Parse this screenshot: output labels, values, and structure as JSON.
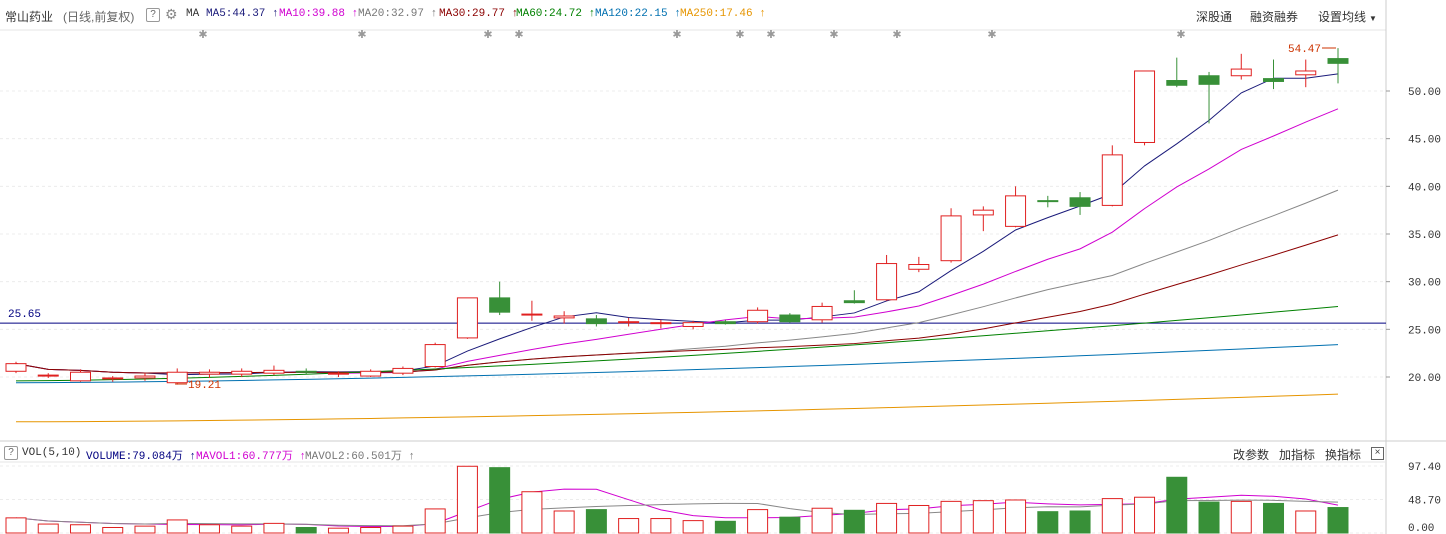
{
  "header": {
    "stock_name": "常山药业",
    "period_label": "(日线,前复权)",
    "ma_label": "MA",
    "ma_items": [
      {
        "label": "MA5:44.37",
        "color": "#1a1a7a"
      },
      {
        "label": "MA10:39.88",
        "color": "#d000d0"
      },
      {
        "label": "MA20:32.97",
        "color": "#777777"
      },
      {
        "label": "MA30:29.77",
        "color": "#8b0000"
      },
      {
        "label": "MA60:24.72",
        "color": "#008000"
      },
      {
        "label": "MA120:22.15",
        "color": "#0070b0"
      },
      {
        "label": "MA250:17.46",
        "color": "#e69500"
      }
    ],
    "buttons": {
      "shengutong": "深股通",
      "rongzi": "融资融券",
      "setma": "设置均线"
    }
  },
  "volume_header": {
    "vol_label": "VOL(5,10)",
    "items": [
      {
        "label": "VOLUME:79.084万",
        "color": "#000080"
      },
      {
        "label": "MAVOL1:60.777万",
        "color": "#d000d0"
      },
      {
        "label": "MAVOL2:60.501万",
        "color": "#777777"
      }
    ],
    "buttons": {
      "params": "改参数",
      "add": "加指标",
      "switch": "换指标"
    }
  },
  "colors": {
    "up": "#e02020",
    "down": "#389038",
    "ref_line": "#000080",
    "ma5": "#1a1a7a",
    "ma10": "#d000d0",
    "ma20": "#888888",
    "ma30": "#8b0000",
    "ma60": "#008000",
    "ma120": "#0070b0",
    "ma250": "#e69500",
    "mavol1": "#d000d0",
    "mavol2": "#888888"
  },
  "chart_data": {
    "type": "candlestick",
    "price_axis": {
      "ticks": [
        "50.00",
        "45.00",
        "40.00",
        "35.00",
        "30.00",
        "25.00",
        "20.00"
      ],
      "range": [
        15.0,
        55.0
      ]
    },
    "volume_axis": {
      "ticks": [
        "97.40",
        "48.70",
        "0.00"
      ],
      "range": [
        0,
        105
      ]
    },
    "reference_line": {
      "value": 25.65,
      "label": "25.65"
    },
    "annotations": {
      "max_label": "54.47",
      "min_label": "19.21"
    },
    "candles": [
      {
        "o": 20.6,
        "h": 21.6,
        "l": 20.4,
        "c": 21.4
      },
      {
        "o": 20.2,
        "h": 20.4,
        "l": 19.9,
        "c": 20.2
      },
      {
        "o": 19.6,
        "h": 20.8,
        "l": 19.5,
        "c": 20.5
      },
      {
        "o": 19.8,
        "h": 20.1,
        "l": 19.5,
        "c": 19.9
      },
      {
        "o": 19.9,
        "h": 20.4,
        "l": 19.6,
        "c": 20.1
      },
      {
        "o": 19.4,
        "h": 20.9,
        "l": 19.2,
        "c": 20.5
      },
      {
        "o": 20.3,
        "h": 20.8,
        "l": 19.9,
        "c": 20.5
      },
      {
        "o": 20.3,
        "h": 20.9,
        "l": 20.0,
        "c": 20.6
      },
      {
        "o": 20.4,
        "h": 21.2,
        "l": 20.2,
        "c": 20.7
      },
      {
        "o": 20.6,
        "h": 20.9,
        "l": 20.3,
        "c": 20.5
      },
      {
        "o": 20.3,
        "h": 20.6,
        "l": 20.0,
        "c": 20.4
      },
      {
        "o": 20.1,
        "h": 20.8,
        "l": 20.0,
        "c": 20.6
      },
      {
        "o": 20.4,
        "h": 21.1,
        "l": 20.2,
        "c": 20.9
      },
      {
        "o": 21.1,
        "h": 23.6,
        "l": 21.0,
        "c": 23.4
      },
      {
        "o": 24.1,
        "h": 28.3,
        "l": 24.0,
        "c": 28.3
      },
      {
        "o": 28.3,
        "h": 30.0,
        "l": 26.5,
        "c": 26.8
      },
      {
        "o": 26.6,
        "h": 28.0,
        "l": 25.9,
        "c": 26.6
      },
      {
        "o": 26.2,
        "h": 26.9,
        "l": 25.6,
        "c": 26.4
      },
      {
        "o": 26.1,
        "h": 26.5,
        "l": 25.3,
        "c": 25.6
      },
      {
        "o": 25.7,
        "h": 26.2,
        "l": 25.3,
        "c": 25.8
      },
      {
        "o": 25.6,
        "h": 26.0,
        "l": 25.1,
        "c": 25.7
      },
      {
        "o": 25.3,
        "h": 25.9,
        "l": 25.0,
        "c": 25.7
      },
      {
        "o": 25.8,
        "h": 26.0,
        "l": 25.5,
        "c": 25.6
      },
      {
        "o": 25.8,
        "h": 27.3,
        "l": 25.6,
        "c": 27.0
      },
      {
        "o": 26.5,
        "h": 26.7,
        "l": 25.7,
        "c": 25.8
      },
      {
        "o": 26.0,
        "h": 27.8,
        "l": 25.7,
        "c": 27.4
      },
      {
        "o": 28.0,
        "h": 29.1,
        "l": 27.7,
        "c": 27.8
      },
      {
        "o": 28.1,
        "h": 32.8,
        "l": 28.0,
        "c": 31.9
      },
      {
        "o": 31.3,
        "h": 32.6,
        "l": 31.0,
        "c": 31.8
      },
      {
        "o": 32.2,
        "h": 37.7,
        "l": 32.0,
        "c": 36.9
      },
      {
        "o": 37.0,
        "h": 37.9,
        "l": 35.3,
        "c": 37.5
      },
      {
        "o": 35.8,
        "h": 40.0,
        "l": 35.7,
        "c": 39.0
      },
      {
        "o": 38.5,
        "h": 39.0,
        "l": 37.8,
        "c": 38.4
      },
      {
        "o": 38.8,
        "h": 39.4,
        "l": 37.0,
        "c": 37.9
      },
      {
        "o": 38.0,
        "h": 44.3,
        "l": 37.9,
        "c": 43.3
      },
      {
        "o": 44.6,
        "h": 52.1,
        "l": 44.3,
        "c": 52.1
      },
      {
        "o": 51.1,
        "h": 53.5,
        "l": 50.4,
        "c": 50.6
      },
      {
        "o": 51.6,
        "h": 52.0,
        "l": 46.6,
        "c": 50.7
      },
      {
        "o": 51.6,
        "h": 53.9,
        "l": 51.2,
        "c": 52.3
      },
      {
        "o": 51.3,
        "h": 53.3,
        "l": 50.2,
        "c": 51.0
      },
      {
        "o": 51.7,
        "h": 53.3,
        "l": 50.4,
        "c": 52.1
      },
      {
        "o": 53.4,
        "h": 54.5,
        "l": 50.8,
        "c": 52.9
      }
    ],
    "volume": [
      22,
      13,
      12,
      8,
      10,
      19,
      12,
      10,
      14,
      8,
      7,
      8,
      10,
      35,
      97,
      95,
      60,
      32,
      34,
      21,
      21,
      18,
      17,
      34,
      23,
      36,
      33,
      43,
      40,
      46,
      47,
      48,
      31,
      32,
      50,
      52,
      81,
      45,
      46,
      43,
      32,
      37
    ]
  }
}
